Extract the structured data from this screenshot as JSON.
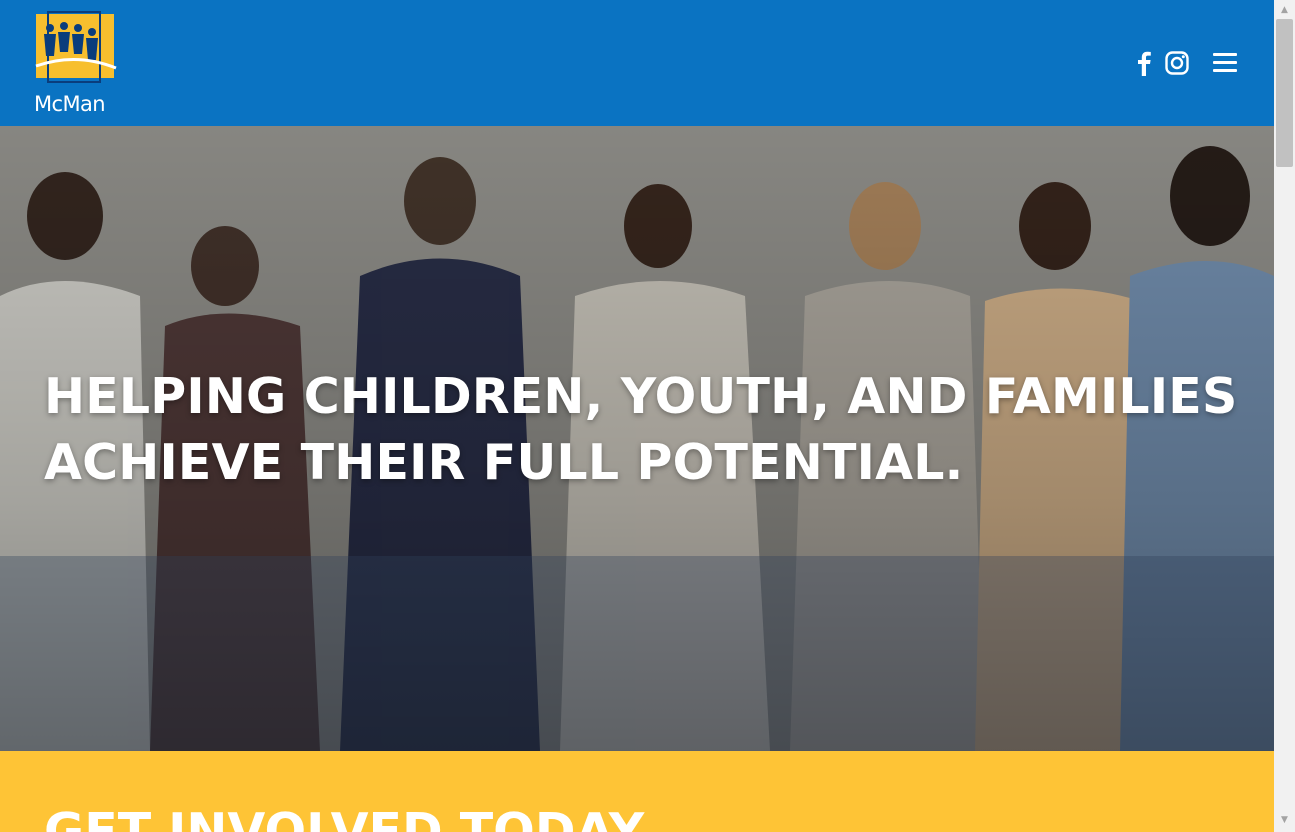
{
  "header": {
    "logo_text": "McMan",
    "social_icons": [
      "facebook-icon",
      "instagram-icon"
    ],
    "menu_icon": "hamburger-menu-icon"
  },
  "hero": {
    "headline": "HELPING CHILDREN, YOUTH, AND FAMILIES ACHIEVE THEIR FULL POTENTIAL."
  },
  "cta": {
    "heading": "GET INVOLVED TODAY"
  },
  "colors": {
    "header_blue": "#0a73c2",
    "logo_yellow": "#f7bf2e",
    "cta_yellow": "#fec436",
    "text_white": "#ffffff"
  }
}
